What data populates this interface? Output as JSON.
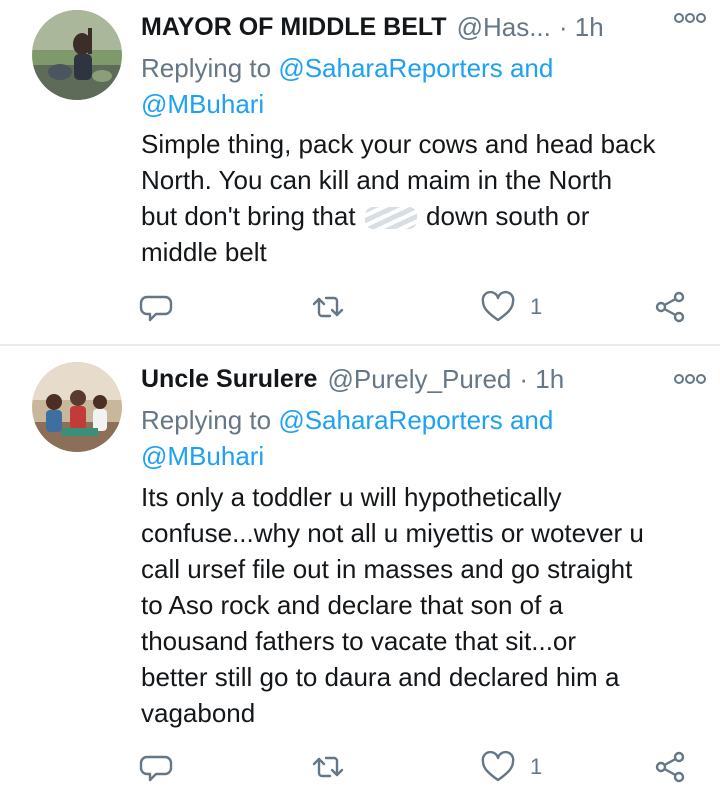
{
  "tweets": [
    {
      "name": "MAYOR OF MIDDLE BELT",
      "handle": "@Has...",
      "time": "· 1h",
      "replying_prefix": "Replying to",
      "mention_1": "@SaharaReporters",
      "mention_and": "and",
      "mention_2": "@MBuhari",
      "body_lines": [
        "Simple thing, pack your cows and head back",
        "North. You can kill and maim in the North",
        "but don't bring that",
        "down south or",
        "middle belt"
      ],
      "like_count": "1",
      "icons": [
        "more-icon",
        "reply-icon",
        "retweet-icon",
        "like-icon",
        "share-icon"
      ]
    },
    {
      "name": "Uncle Surulere",
      "handle": "@Purely_Pured",
      "time": "· 1h",
      "replying_prefix": "Replying to",
      "mention_1": "@SaharaReporters",
      "mention_and": "and",
      "mention_2": "@MBuhari",
      "body_lines": [
        "Its only a toddler u will hypothetically",
        "confuse...why not all u miyettis or wotever u",
        "call ursef file out in masses and go straight",
        "to Aso rock and declare that son of a",
        "thousand fathers to vacate that sit...or",
        "better still go to daura and declared him a",
        "vagabond"
      ],
      "like_count": "1",
      "icons": [
        "more-icon",
        "reply-icon",
        "retweet-icon",
        "like-icon",
        "share-icon"
      ]
    }
  ],
  "colors": {
    "text": "#14171a",
    "secondary": "#657786",
    "link": "#1da1f2",
    "divider": "#e6ecf0"
  }
}
